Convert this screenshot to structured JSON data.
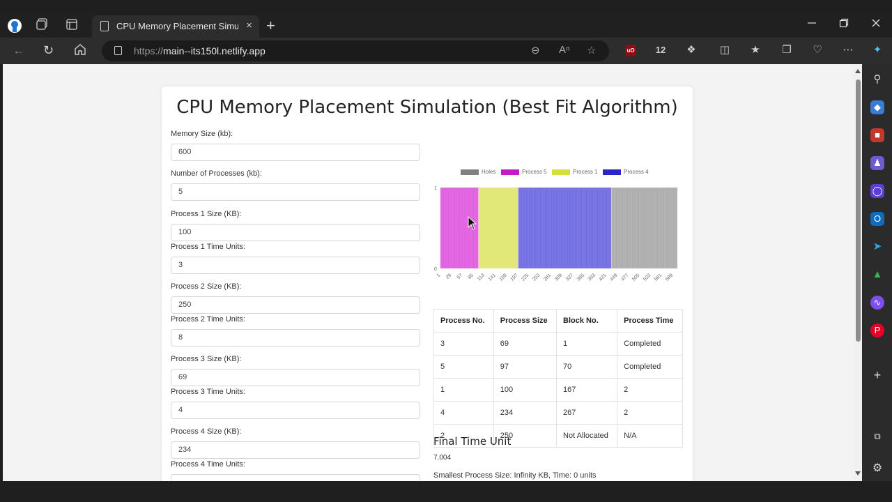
{
  "browser": {
    "tab_title": "CPU Memory Placement Simulati",
    "url_prefix": "https://",
    "url_host": "main--its150l.netlify.app",
    "tab_close": "×",
    "new_tab": "+"
  },
  "page": {
    "title": "CPU Memory Placement Simulation (Best Fit Algorithm)",
    "fields": [
      {
        "label": "Memory Size (kb):",
        "value": "600"
      },
      {
        "label": "Number of Processes (kb):",
        "value": "5"
      },
      {
        "label": "Process 1 Size (KB):",
        "value": "100"
      },
      {
        "label": "Process 1 Time Units:",
        "value": "3"
      },
      {
        "label": "Process 2 Size (KB):",
        "value": "250"
      },
      {
        "label": "Process 2 Time Units:",
        "value": "8"
      },
      {
        "label": "Process 3 Size (KB):",
        "value": "69"
      },
      {
        "label": "Process 3 Time Units:",
        "value": "4"
      },
      {
        "label": "Process 4 Size (KB):",
        "value": "234"
      },
      {
        "label": "Process 4 Time Units:",
        "value": ""
      }
    ],
    "table": {
      "headers": [
        "Process No.",
        "Process Size",
        "Block No.",
        "Process Time"
      ],
      "rows": [
        [
          "3",
          "69",
          "1",
          "Completed"
        ],
        [
          "5",
          "97",
          "70",
          "Completed"
        ],
        [
          "1",
          "100",
          "167",
          "2"
        ],
        [
          "4",
          "234",
          "267",
          "2"
        ],
        [
          "2",
          "250",
          "Not Allocated",
          "N/A"
        ]
      ]
    },
    "final_time_title": "Final Time Unit",
    "final_time_value": "7.004",
    "smallest_text": "Smallest Process Size: Infinity KB, Time: 0 units"
  },
  "chart_data": {
    "type": "bar",
    "title": "",
    "xlabel": "",
    "ylabel": "",
    "ylim": [
      0,
      1
    ],
    "y_ticks": [
      "0",
      "1"
    ],
    "x_tick_labels": [
      "1",
      "29",
      "57",
      "85",
      "113",
      "141",
      "169",
      "197",
      "225",
      "253",
      "281",
      "309",
      "337",
      "365",
      "393",
      "421",
      "449",
      "477",
      "505",
      "533",
      "561",
      "589"
    ],
    "legend_position": "top",
    "series": [
      {
        "name": "Holes",
        "color": "#808080",
        "fill": "#b3b3b3",
        "segments": [
          [
            434,
            600
          ]
        ]
      },
      {
        "name": "Process 5",
        "color": "#c71ac7",
        "fill": "#e36ae3",
        "segments": [
          [
            1,
            97
          ]
        ]
      },
      {
        "name": "Process 1",
        "color": "#d6df3a",
        "fill": "#e3e87a",
        "segments": [
          [
            98,
            197
          ]
        ]
      },
      {
        "name": "Process 4",
        "color": "#2b26c9",
        "fill": "#7b78e6",
        "segments": [
          [
            198,
            433
          ]
        ]
      }
    ]
  },
  "colors": {
    "accent": "#1a73e8",
    "chrome_bg": "#202020"
  }
}
